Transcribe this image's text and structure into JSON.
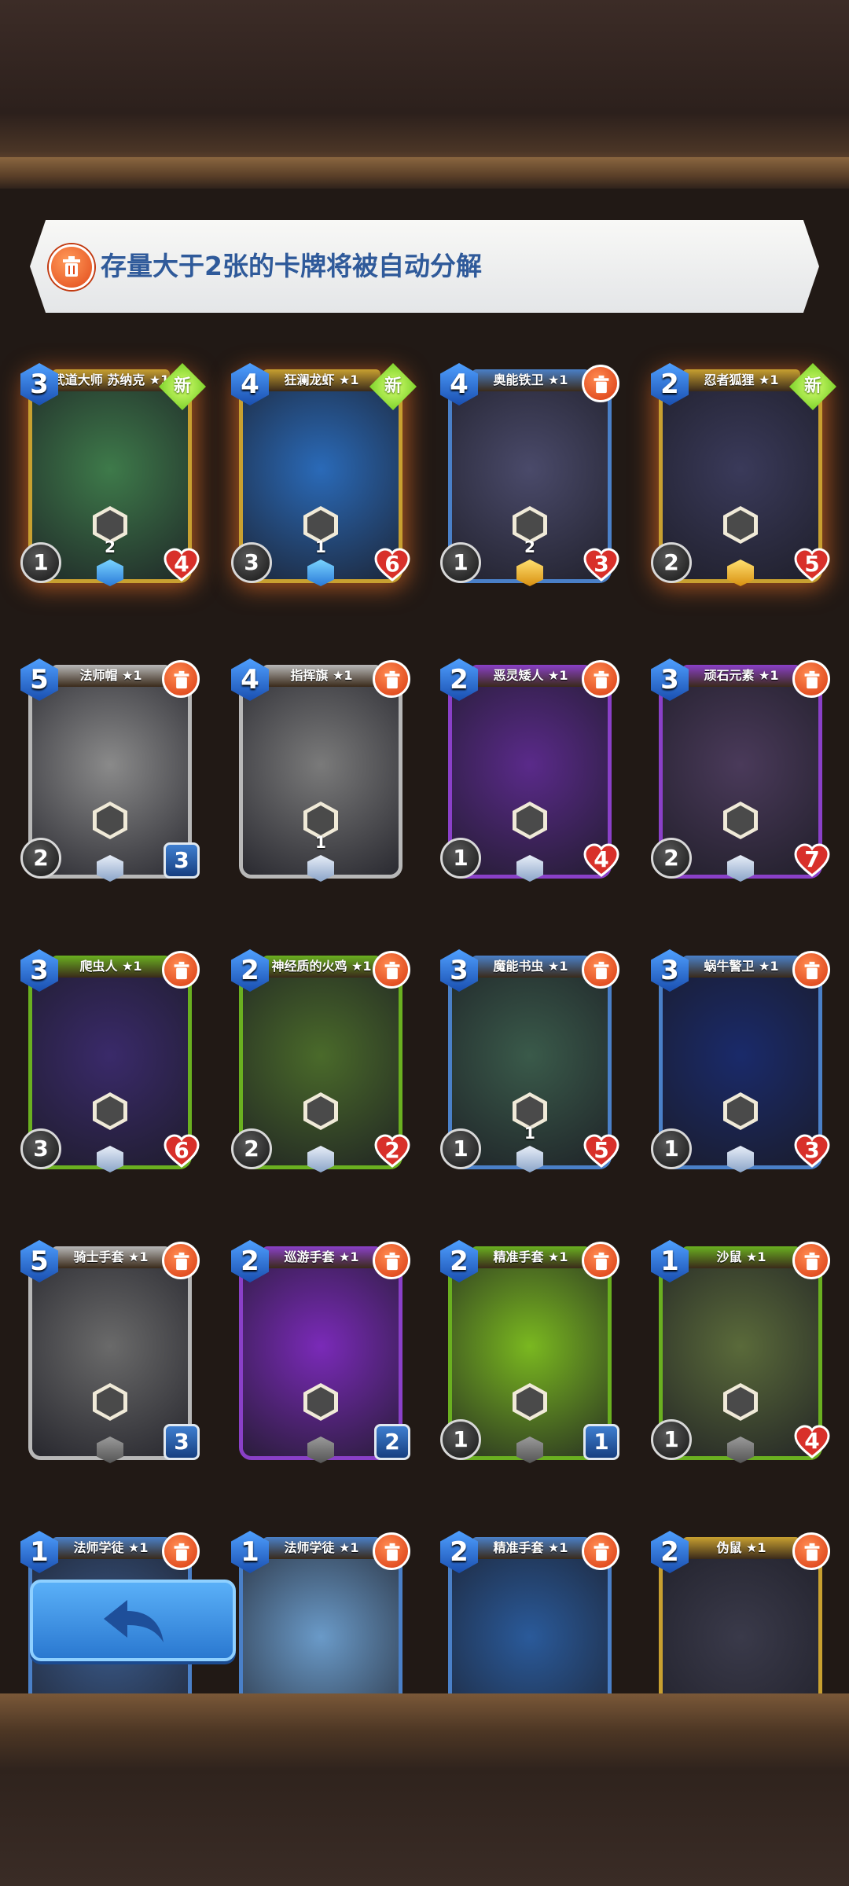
{
  "notice": {
    "text": "存量大于2张的卡牌将被自动分解"
  },
  "colors": {
    "gold_frame": "#c8a030",
    "blue_frame": "#4a80c8",
    "grey_frame": "#b8b8b8",
    "purple_frame": "#8a40c8",
    "green_frame": "#6ab020",
    "accent": "#2f5a9a"
  },
  "badge_new_label": "新",
  "cards": [
    {
      "name": "武道大师 苏纳克 ★1",
      "cost": "3",
      "atk": "1",
      "hp": "4",
      "hp_type": "heart",
      "frame": "gold",
      "art": "#3e7a4a",
      "ability": "2",
      "new": true,
      "trash": false,
      "gem": "star"
    },
    {
      "name": "狂澜龙虾 ★1",
      "cost": "4",
      "atk": "3",
      "hp": "6",
      "hp_type": "heart",
      "frame": "gold",
      "art": "#2a6ab8",
      "ability": "1",
      "new": true,
      "trash": false,
      "gem": "star"
    },
    {
      "name": "奥能铁卫 ★1",
      "cost": "4",
      "atk": "1",
      "hp": "3",
      "hp_type": "heart",
      "frame": "blue",
      "art": "#4a4a6a",
      "ability": "2",
      "new": false,
      "trash": true,
      "gem": "gold"
    },
    {
      "name": "忍者狐狸 ★1",
      "cost": "2",
      "atk": "2",
      "hp": "5",
      "hp_type": "heart",
      "frame": "gold",
      "art": "#3a3a5a",
      "ability": "",
      "new": true,
      "trash": false,
      "gem": "gold"
    },
    {
      "name": "法师帽 ★1",
      "cost": "5",
      "atk": "2",
      "hp": "3",
      "hp_type": "shield",
      "frame": "grey",
      "art": "#8a8a8a",
      "ability": "",
      "new": false,
      "trash": true,
      "gem": "silver"
    },
    {
      "name": "指挥旗 ★1",
      "cost": "4",
      "atk": "",
      "hp": "",
      "hp_type": "none",
      "frame": "grey",
      "art": "#7a7a7a",
      "ability": "1",
      "new": false,
      "trash": true,
      "gem": "silver"
    },
    {
      "name": "恶灵矮人 ★1",
      "cost": "2",
      "atk": "1",
      "hp": "4",
      "hp_type": "heart",
      "frame": "purple",
      "art": "#5a2a8a",
      "ability": "",
      "new": false,
      "trash": true,
      "gem": "silver"
    },
    {
      "name": "顽石元素 ★1",
      "cost": "3",
      "atk": "2",
      "hp": "7",
      "hp_type": "heart",
      "frame": "purple",
      "art": "#4a3a5a",
      "ability": "",
      "new": false,
      "trash": true,
      "gem": "silver"
    },
    {
      "name": "爬虫人 ★1",
      "cost": "3",
      "atk": "3",
      "hp": "6",
      "hp_type": "heart",
      "frame": "green",
      "art": "#3a2a6a",
      "ability": "",
      "new": false,
      "trash": true,
      "gem": "silver"
    },
    {
      "name": "神经质的火鸡 ★1",
      "cost": "2",
      "atk": "2",
      "hp": "2",
      "hp_type": "heart",
      "frame": "green",
      "art": "#4a6a2a",
      "ability": "",
      "new": false,
      "trash": true,
      "gem": "silver"
    },
    {
      "name": "魔能书虫 ★1",
      "cost": "3",
      "atk": "1",
      "hp": "5",
      "hp_type": "heart",
      "frame": "blue",
      "art": "#3a5a4a",
      "ability": "1",
      "new": false,
      "trash": true,
      "gem": "silver"
    },
    {
      "name": "蜗牛警卫 ★1",
      "cost": "3",
      "atk": "1",
      "hp": "3",
      "hp_type": "heart",
      "frame": "blue",
      "art": "#1a2a6a",
      "ability": "",
      "new": false,
      "trash": true,
      "gem": "silver"
    },
    {
      "name": "骑士手套 ★1",
      "cost": "5",
      "atk": "",
      "hp": "3",
      "hp_type": "shield",
      "frame": "grey",
      "art": "#6a6a6a",
      "ability": "",
      "new": false,
      "trash": true,
      "gem": "grey"
    },
    {
      "name": "巡游手套 ★1",
      "cost": "2",
      "atk": "",
      "hp": "2",
      "hp_type": "shield",
      "frame": "purple",
      "art": "#7a2ab8",
      "ability": "",
      "new": false,
      "trash": true,
      "gem": "grey"
    },
    {
      "name": "精准手套 ★1",
      "cost": "2",
      "atk": "1",
      "hp": "1",
      "hp_type": "shield",
      "frame": "green",
      "art": "#7ab820",
      "ability": "",
      "new": false,
      "trash": true,
      "gem": "grey"
    },
    {
      "name": "沙鼠 ★1",
      "cost": "1",
      "atk": "1",
      "hp": "4",
      "hp_type": "heart",
      "frame": "green",
      "art": "#5a6a3a",
      "ability": "",
      "new": false,
      "trash": true,
      "gem": "grey"
    },
    {
      "name": "法师学徒 ★1",
      "cost": "1",
      "atk": "",
      "hp": "",
      "hp_type": "none",
      "frame": "blue",
      "art": "#3a5a8a",
      "ability": "",
      "new": false,
      "trash": true,
      "gem": "none"
    },
    {
      "name": "法师学徒 ★1",
      "cost": "1",
      "atk": "",
      "hp": "",
      "hp_type": "none",
      "frame": "blue",
      "art": "#6a9ac8",
      "ability": "",
      "new": false,
      "trash": true,
      "gem": "none"
    },
    {
      "name": "精准手套 ★1",
      "cost": "2",
      "atk": "",
      "hp": "",
      "hp_type": "none",
      "frame": "blue",
      "art": "#2a5a9a",
      "ability": "",
      "new": false,
      "trash": true,
      "gem": "none"
    },
    {
      "name": "伪鼠 ★1",
      "cost": "2",
      "atk": "",
      "hp": "",
      "hp_type": "none",
      "frame": "gold",
      "art": "#3a3a4a",
      "ability": "",
      "new": false,
      "trash": true,
      "gem": "none"
    }
  ]
}
